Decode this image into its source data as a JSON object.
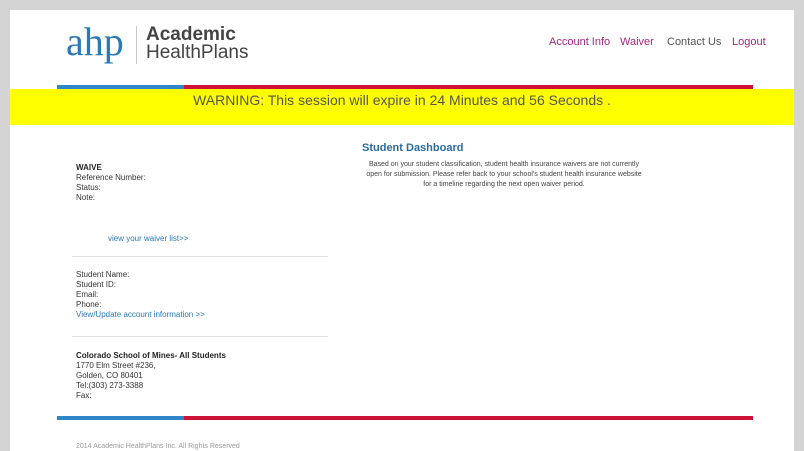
{
  "logo": {
    "mark": "ahp",
    "line1": "Academic",
    "line2": "HealthPlans"
  },
  "nav": {
    "account_info": "Account Info",
    "waiver": "Waiver",
    "contact_us": "Contact Us",
    "logout": "Logout"
  },
  "warning": "WARNING: This session will expire in 24 Minutes and 56 Seconds .",
  "waive": {
    "heading": "WAIVE",
    "reference_label": "Reference Number:",
    "status_label": "Status:",
    "note_label": "Note:",
    "list_link": "view your waiver list>>"
  },
  "student": {
    "name_label": "Student Name:",
    "id_label": "Student ID:",
    "email_label": "Email:",
    "phone_label": "Phone:",
    "update_link": "View/Update account information >>"
  },
  "school": {
    "name": "Colorado School of Mines- All Students",
    "address1": "1770 Elm Street #236,",
    "address2": "Golden, CO 80401",
    "tel": "Tel:(303) 273-3388",
    "fax": "Fax:"
  },
  "dashboard": {
    "title": "Student Dashboard",
    "line1": "Based on your student classification, student health insurance waivers are not currently",
    "line2": "open for submission. Please refer back to your school's student health insurance website",
    "line3": "for a timeline regarding the next open waiver period."
  },
  "footer": "2014 Academic HealthPlans Inc. All Rights Reserved",
  "colors": {
    "blue": "#2f86c8",
    "red": "#cc1236",
    "warning_bg": "#ffff00",
    "nav_purple": "#a3277e"
  }
}
